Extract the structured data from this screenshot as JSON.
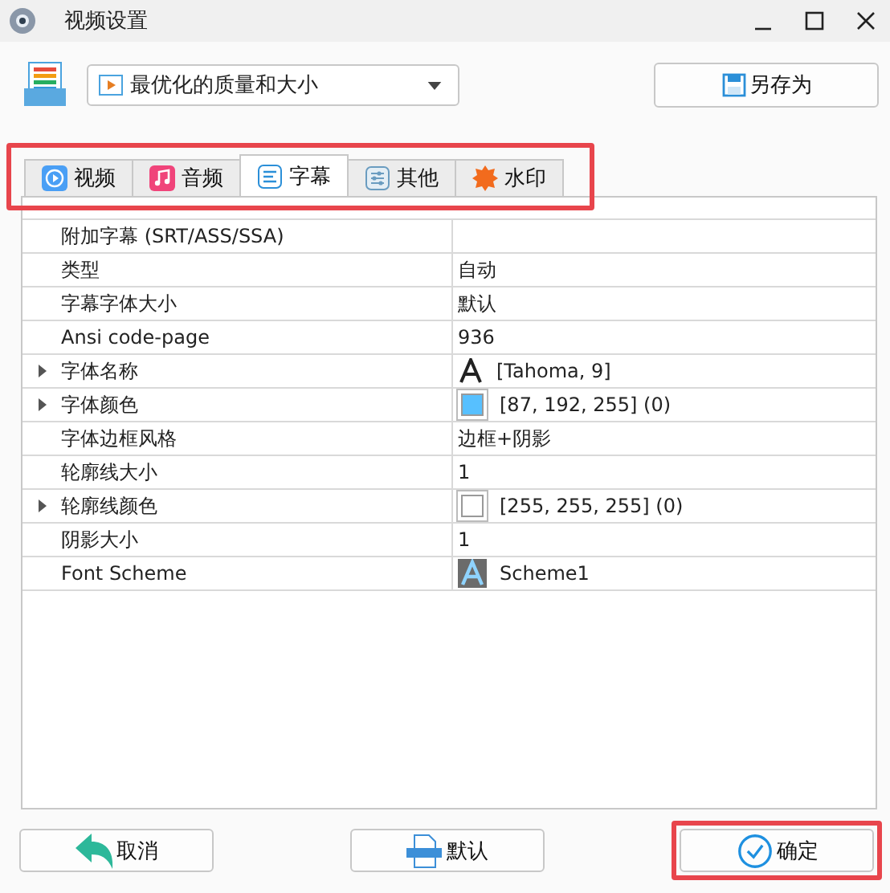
{
  "window": {
    "title": "视频设置"
  },
  "preset": {
    "value": "最优化的质量和大小"
  },
  "save_as_button": "另存为",
  "tabs_highlighted": true,
  "tabs": [
    {
      "label": "视频",
      "kind": "video",
      "selected": false
    },
    {
      "label": "音频",
      "kind": "audio",
      "selected": false
    },
    {
      "label": "字幕",
      "kind": "subtitle",
      "selected": true
    },
    {
      "label": "其他",
      "kind": "other",
      "selected": false
    },
    {
      "label": "水印",
      "kind": "watermark",
      "selected": false
    }
  ],
  "properties": [
    {
      "name": "附加字幕 (SRT/ASS/SSA)",
      "disabled": false
    },
    {
      "name": "类型",
      "value": "自动",
      "disabled": false
    },
    {
      "name": "字幕字体大小",
      "value": "默认",
      "disabled": false
    },
    {
      "name": "Ansi code-page",
      "value": "936",
      "disabled": false
    },
    {
      "name": "字体名称",
      "value": "[Tahoma, 9]",
      "kind": "font",
      "expandable": true,
      "disabled": false
    },
    {
      "name": "字体颜色",
      "value": "[87, 192, 255] (0)",
      "kind": "color",
      "color": "#57c0ff",
      "expandable": true,
      "disabled": false
    },
    {
      "name": "字体边框风格",
      "value": "边框+阴影",
      "disabled": false
    },
    {
      "name": "轮廓线大小",
      "value": "1",
      "disabled": false
    },
    {
      "name": "轮廓线颜色",
      "value": "[255, 255, 255] (0)",
      "kind": "color",
      "color": "#ffffff",
      "expandable": true,
      "disabled": false
    },
    {
      "name": "阴影大小",
      "value": "1",
      "disabled": false
    },
    {
      "name": "Font Scheme",
      "value": "Scheme1",
      "kind": "scheme",
      "disabled": false
    }
  ],
  "buttons": [
    {
      "label": "取消",
      "kind": "cancel",
      "highlighted": false
    },
    {
      "label": "默认",
      "kind": "default",
      "highlighted": false
    },
    {
      "label": "确定",
      "kind": "ok",
      "highlighted": true
    }
  ]
}
